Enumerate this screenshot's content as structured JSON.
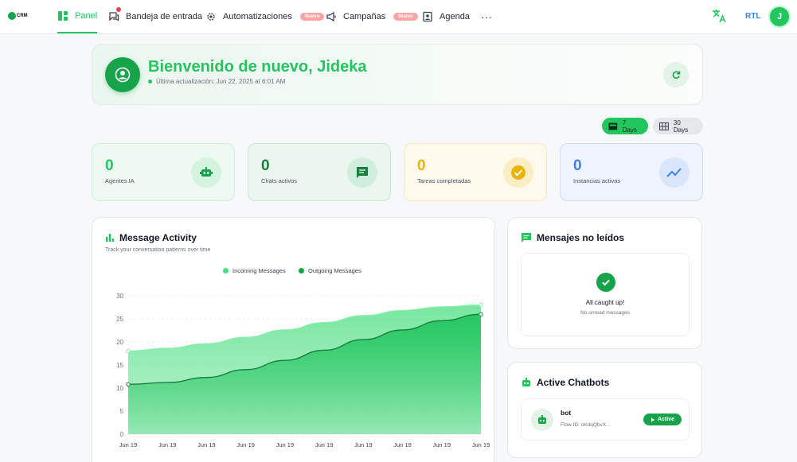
{
  "nav": {
    "logo_text": "CRM",
    "items": [
      {
        "label": "Panel",
        "icon": "dashboard-icon",
        "active": true
      },
      {
        "label": "Bandeja de entrada",
        "icon": "inbox-icon",
        "active": false
      },
      {
        "label": "Automatizaciones",
        "icon": "gear-icon",
        "badge": "Nuevo",
        "active": false
      },
      {
        "label": "Campañas",
        "icon": "megaphone-icon",
        "badge": "Nuevo",
        "active": false
      },
      {
        "label": "Agenda",
        "icon": "contacts-icon",
        "active": false
      }
    ],
    "more": "···",
    "rtl": "RTL",
    "avatar": "J"
  },
  "welcome": {
    "title": "Bienvenido de nuevo, Jideka",
    "updated": "Última actualización: Jun 22, 2025 at 6:01 AM"
  },
  "range": {
    "seven": "7 Days",
    "thirty": "30 Days",
    "selected": "7 Days"
  },
  "stats": [
    {
      "value": "0",
      "label": "Agentes IA",
      "color": "#22c55e",
      "icon": "robot-icon"
    },
    {
      "value": "0",
      "label": "Chats activos",
      "color": "#15803d",
      "icon": "chat-icon"
    },
    {
      "value": "0",
      "label": "Tareas completadas",
      "color": "#eab308",
      "icon": "check-circle-icon"
    },
    {
      "value": "0",
      "label": "Instancias activas",
      "color": "#3b82f6",
      "icon": "trending-icon"
    }
  ],
  "activity": {
    "title": "Message Activity",
    "subtitle": "Track your conversation patterns over time"
  },
  "chart_data": {
    "type": "area",
    "x": [
      "Jun 19",
      "Jun 19",
      "Jun 19",
      "Jun 19",
      "Jun 19",
      "Jun 19",
      "Jun 19",
      "Jun 19",
      "Jun 19",
      "Jun 19"
    ],
    "series": [
      {
        "name": "Incoming Messages",
        "color": "#4ade80",
        "values": [
          18,
          18.6,
          19.6,
          21,
          22.6,
          24.2,
          25.7,
          26.8,
          27.6,
          28
        ]
      },
      {
        "name": "Outgoing Messages",
        "color": "#22c55e",
        "values": [
          10.8,
          11.2,
          12.3,
          14,
          16,
          18.2,
          20.5,
          22.6,
          24.6,
          26
        ]
      }
    ],
    "yticks": [
      0,
      5,
      10,
      15,
      20,
      25,
      30
    ],
    "ylim": [
      0,
      30
    ],
    "legend": "top-center",
    "grid": true
  },
  "unread": {
    "title": "Mensajes no leídos",
    "caught": "All caught up!",
    "none": "No unread messages"
  },
  "chatbots": {
    "title": "Active Chatbots",
    "bot_name": "bot",
    "flow": "Flow ID: oKdqQbvX...",
    "status": "Active"
  }
}
